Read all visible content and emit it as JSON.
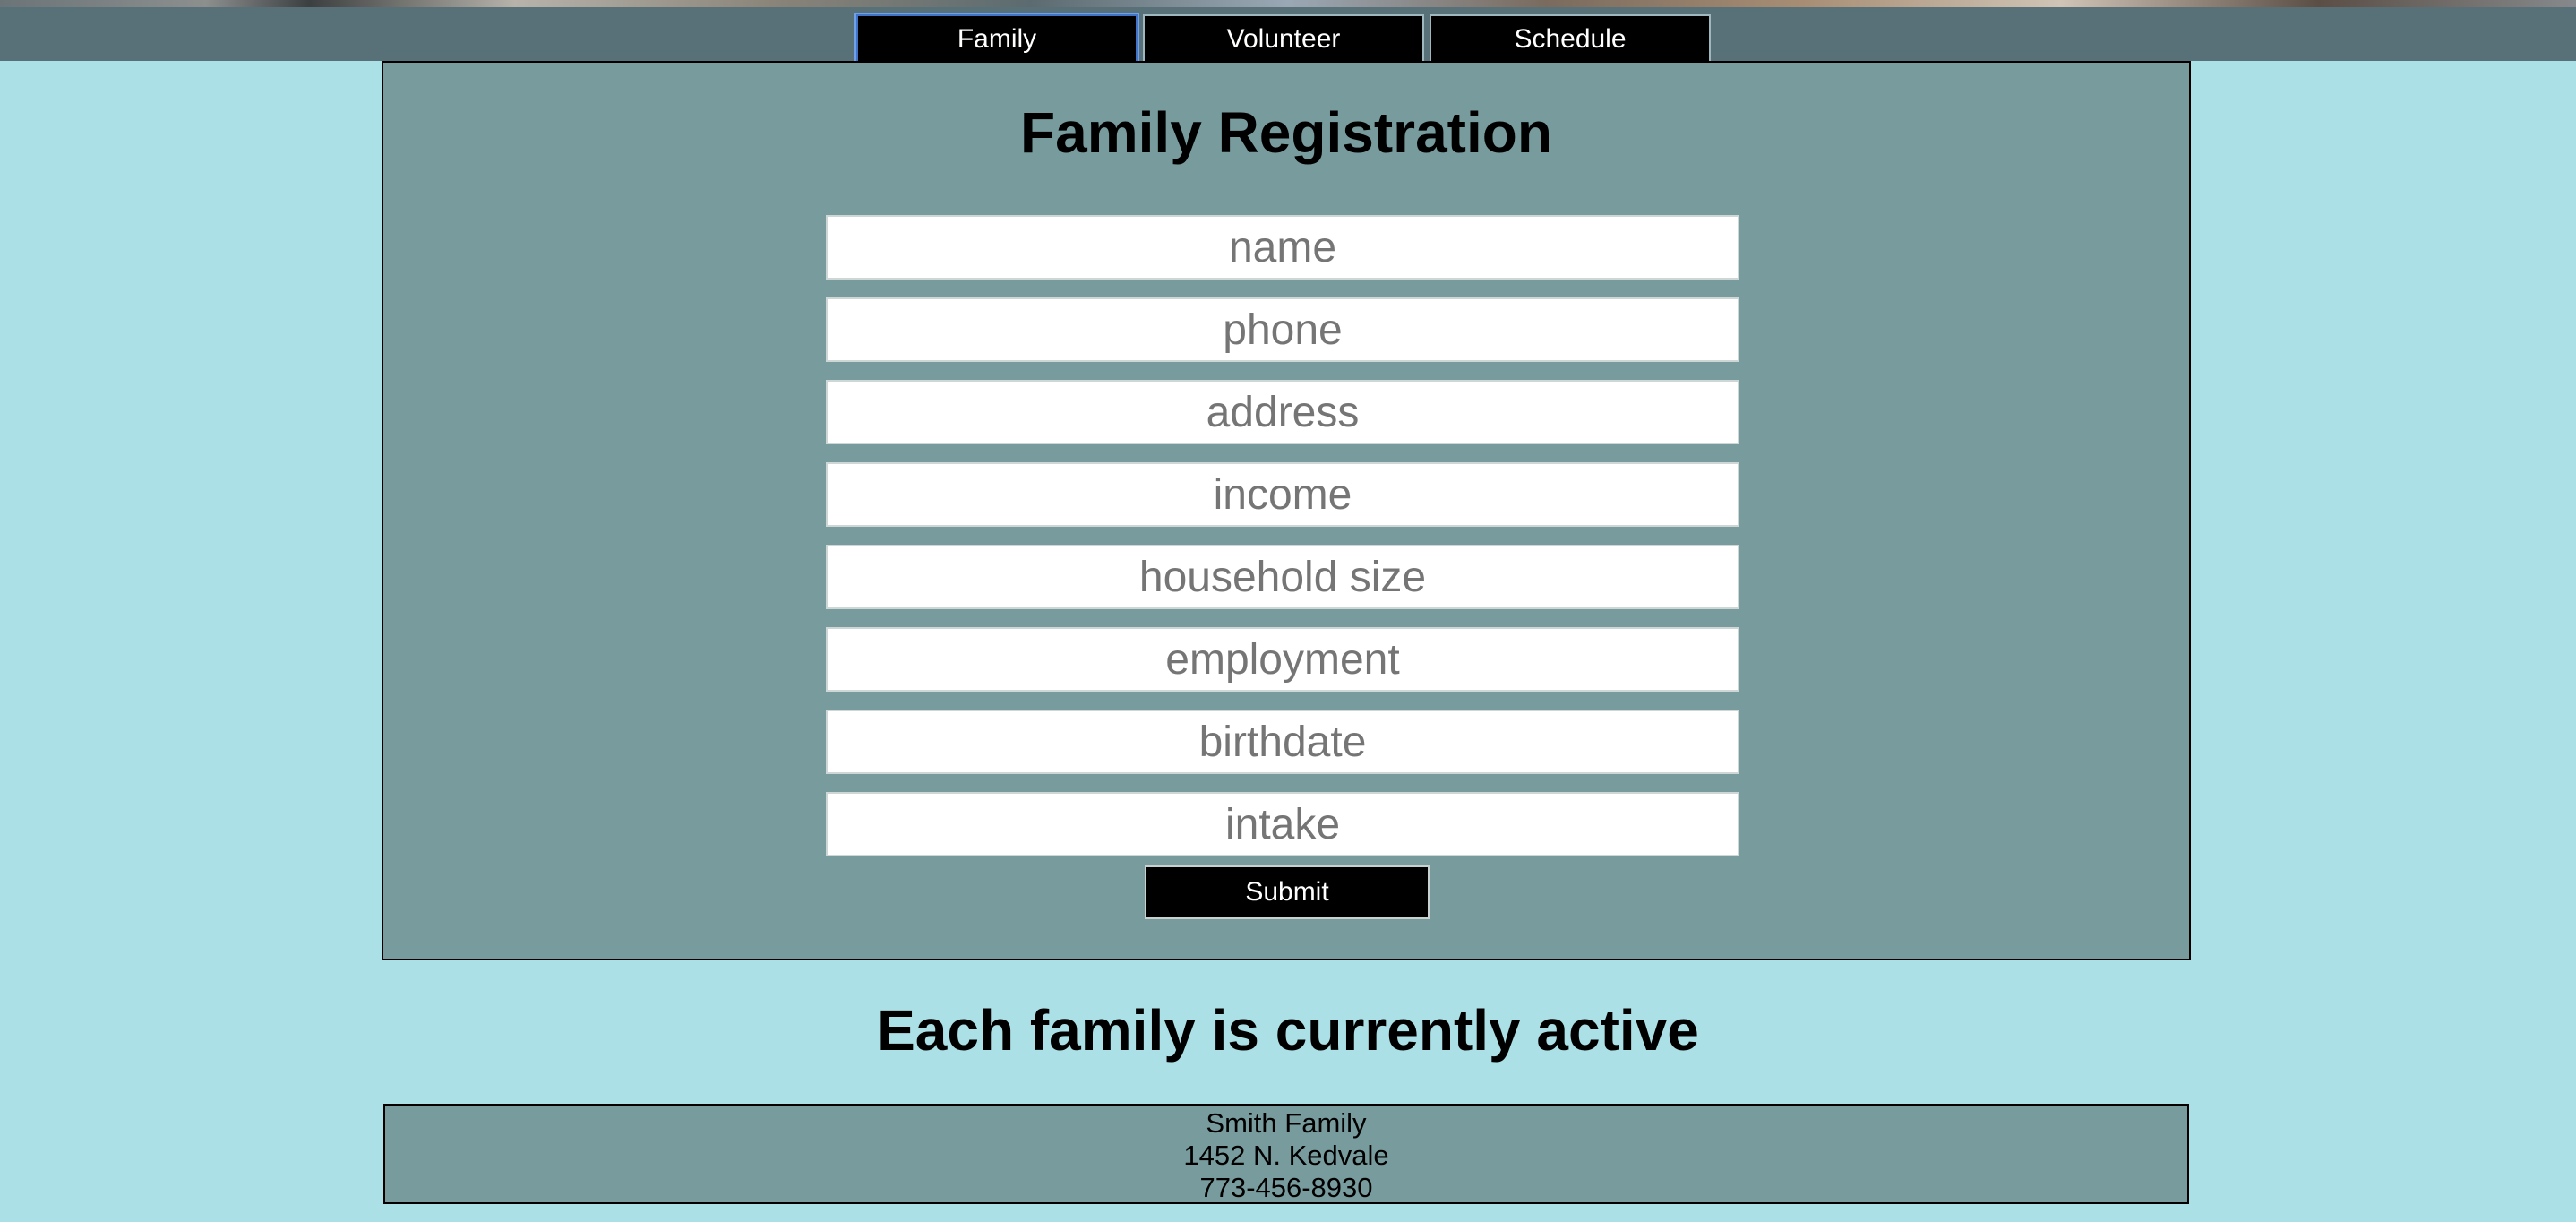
{
  "nav": {
    "items": [
      {
        "label": "Family",
        "active": true
      },
      {
        "label": "Volunteer",
        "active": false
      },
      {
        "label": "Schedule",
        "active": false
      }
    ]
  },
  "registration": {
    "title": "Family Registration",
    "fields": [
      {
        "placeholder": "name",
        "value": ""
      },
      {
        "placeholder": "phone",
        "value": ""
      },
      {
        "placeholder": "address",
        "value": ""
      },
      {
        "placeholder": "income",
        "value": ""
      },
      {
        "placeholder": "household size",
        "value": ""
      },
      {
        "placeholder": "employment",
        "value": ""
      },
      {
        "placeholder": "birthdate",
        "value": ""
      },
      {
        "placeholder": "intake",
        "value": ""
      }
    ],
    "submit_label": "Submit"
  },
  "active_section": {
    "heading": "Each family is currently active",
    "families": [
      {
        "name": "Smith Family",
        "address": "1452 N. Kedvale",
        "phone": "773-456-8930"
      }
    ]
  },
  "colors": {
    "page_background": "#abe0e6",
    "nav_bar": "#587178",
    "panel": "#789c9e",
    "button": "#000000",
    "active_tab_border": "#3f74c8"
  }
}
